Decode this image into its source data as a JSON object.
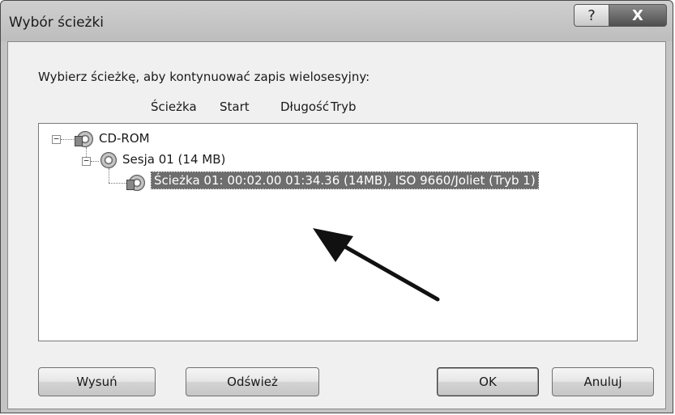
{
  "window": {
    "title": "Wybór ścieżki",
    "help_button": "?",
    "close_button": "X"
  },
  "instruction": "Wybierz ścieżkę, aby kontynuować zapis wielosesyjny:",
  "columns": {
    "path": "Ścieżka",
    "start": "Start",
    "length": "Długość",
    "mode": "Tryb"
  },
  "tree": {
    "root": {
      "label": "CD-ROM",
      "expander": "−"
    },
    "session": {
      "label": "Sesja 01 (14 MB)",
      "expander": "−"
    },
    "track": {
      "label": "Ścieżka 01: 00:02.00 01:34.36 (14MB), ISO 9660/Joliet (Tryb 1)",
      "selected": true
    }
  },
  "buttons": {
    "eject": "Wysuń",
    "refresh": "Odśwież",
    "ok": "OK",
    "cancel": "Anuluj"
  }
}
